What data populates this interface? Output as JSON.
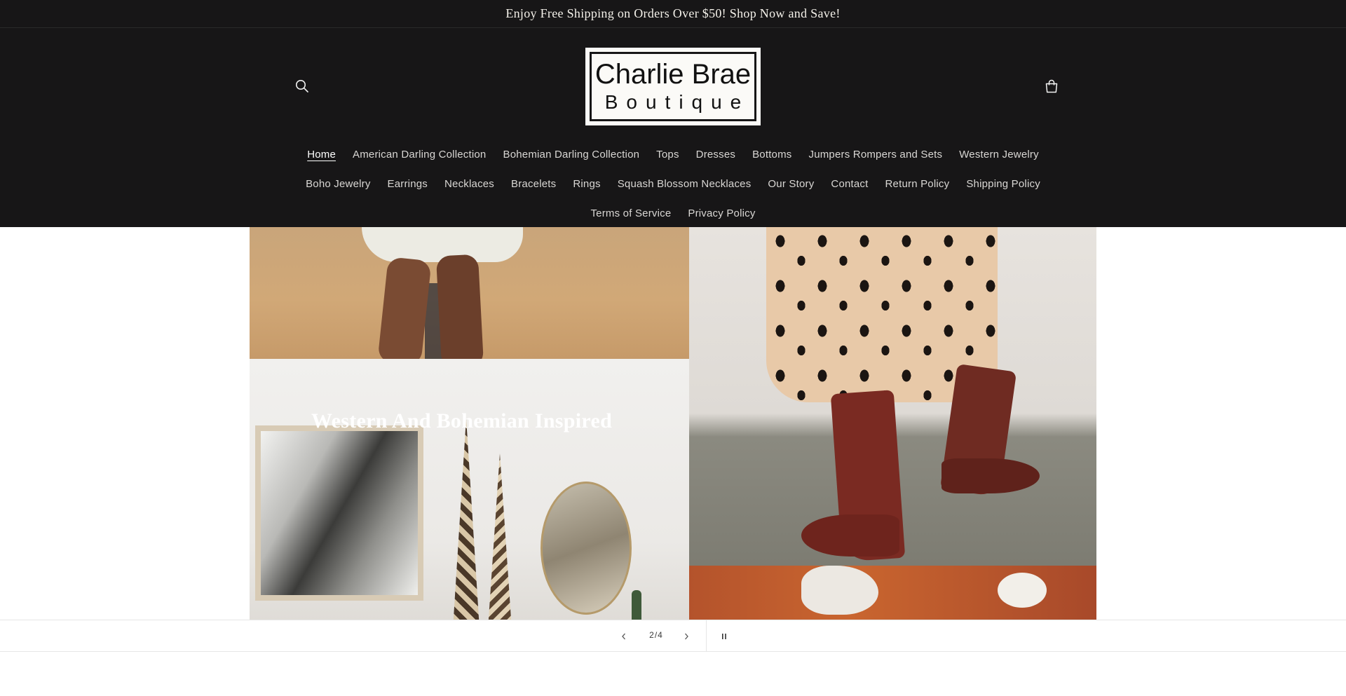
{
  "announcement": {
    "text": "Enjoy Free Shipping on Orders Over $50! Shop Now and Save!"
  },
  "header": {
    "logo": {
      "line1": "Charlie Brae",
      "line2": "Boutique"
    },
    "search_icon": "search-icon",
    "cart_icon": "cart-icon"
  },
  "nav": {
    "row1": [
      "Home",
      "American Darling Collection",
      "Bohemian Darling Collection",
      "Tops",
      "Dresses",
      "Bottoms",
      "Jumpers Rompers and Sets",
      "Western Jewelry"
    ],
    "row2": [
      "Boho Jewelry",
      "Earrings",
      "Necklaces",
      "Bracelets",
      "Rings",
      "Squash Blossom Necklaces",
      "Our Story",
      "Contact",
      "Return Policy",
      "Shipping Policy"
    ],
    "row3": [
      "Terms of Service",
      "Privacy Policy"
    ],
    "active": "Home"
  },
  "hero": {
    "heading": "Western And Bohemian Inspired"
  },
  "slider": {
    "counter": "2/4",
    "prev_icon": "chevron-left-icon",
    "next_icon": "chevron-right-icon",
    "pause_icon": "pause-icon"
  },
  "colors": {
    "header_bg": "#171617",
    "nav_text": "#d9d7d4",
    "logo_bg": "#fbfaf7"
  }
}
